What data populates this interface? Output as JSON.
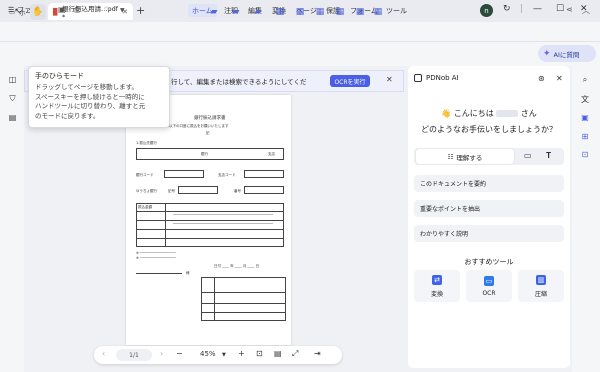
{
  "titlebar": {
    "home_tab": "ホーム",
    "doc_tab": "銀行振込用請…pdf *",
    "avatar_letter": "n"
  },
  "menubar": {
    "file": "ファイル",
    "items": [
      "ホーム",
      "注釈",
      "編集",
      "変換",
      "ページ",
      "保護",
      "フォーム",
      "ツール"
    ],
    "active": "ホーム"
  },
  "toolbar": {
    "ai_button": "AIに質問"
  },
  "ocr": {
    "message": "行して、編集または検索できるようにしてくだ",
    "button": "OCRを実行"
  },
  "tooltip": {
    "title": "手のひらモード",
    "body": [
      "ドラッグしてページを移動します。",
      "スペースキーを押し続けると一時的に",
      "ハンドツールに切り替わり、離すと元",
      "のモードに戻ります。"
    ]
  },
  "document": {
    "title": "銀行振込請求書",
    "subtitle": "この請求書は以下の口座に振込をお願いいたします",
    "labels": [
      "1.振込先銀行",
      "銀行",
      "支店",
      "銀行コード",
      "支店コード",
      "ゆうちょ銀行",
      "記号",
      "番号",
      "振込金額",
      "日付",
      "様"
    ]
  },
  "bottombar": {
    "page": "1/1",
    "zoom": "45%"
  },
  "aipanel": {
    "title": "PDNob AI",
    "greeting": "こんにちは",
    "greeting_suffix": "さん",
    "question": "どのようなお手伝いをしましょうか？",
    "mode": "理解する",
    "suggestions": [
      "このドキュメントを要約",
      "重要なポイントを抽出",
      "わかりやすく説明"
    ],
    "tools_title": "おすすめツール",
    "tools": [
      {
        "label": "変換",
        "color": "#3f63e8"
      },
      {
        "label": "OCR",
        "color": "#2f7be8"
      },
      {
        "label": "圧縮",
        "color": "#3f63e8"
      }
    ]
  }
}
